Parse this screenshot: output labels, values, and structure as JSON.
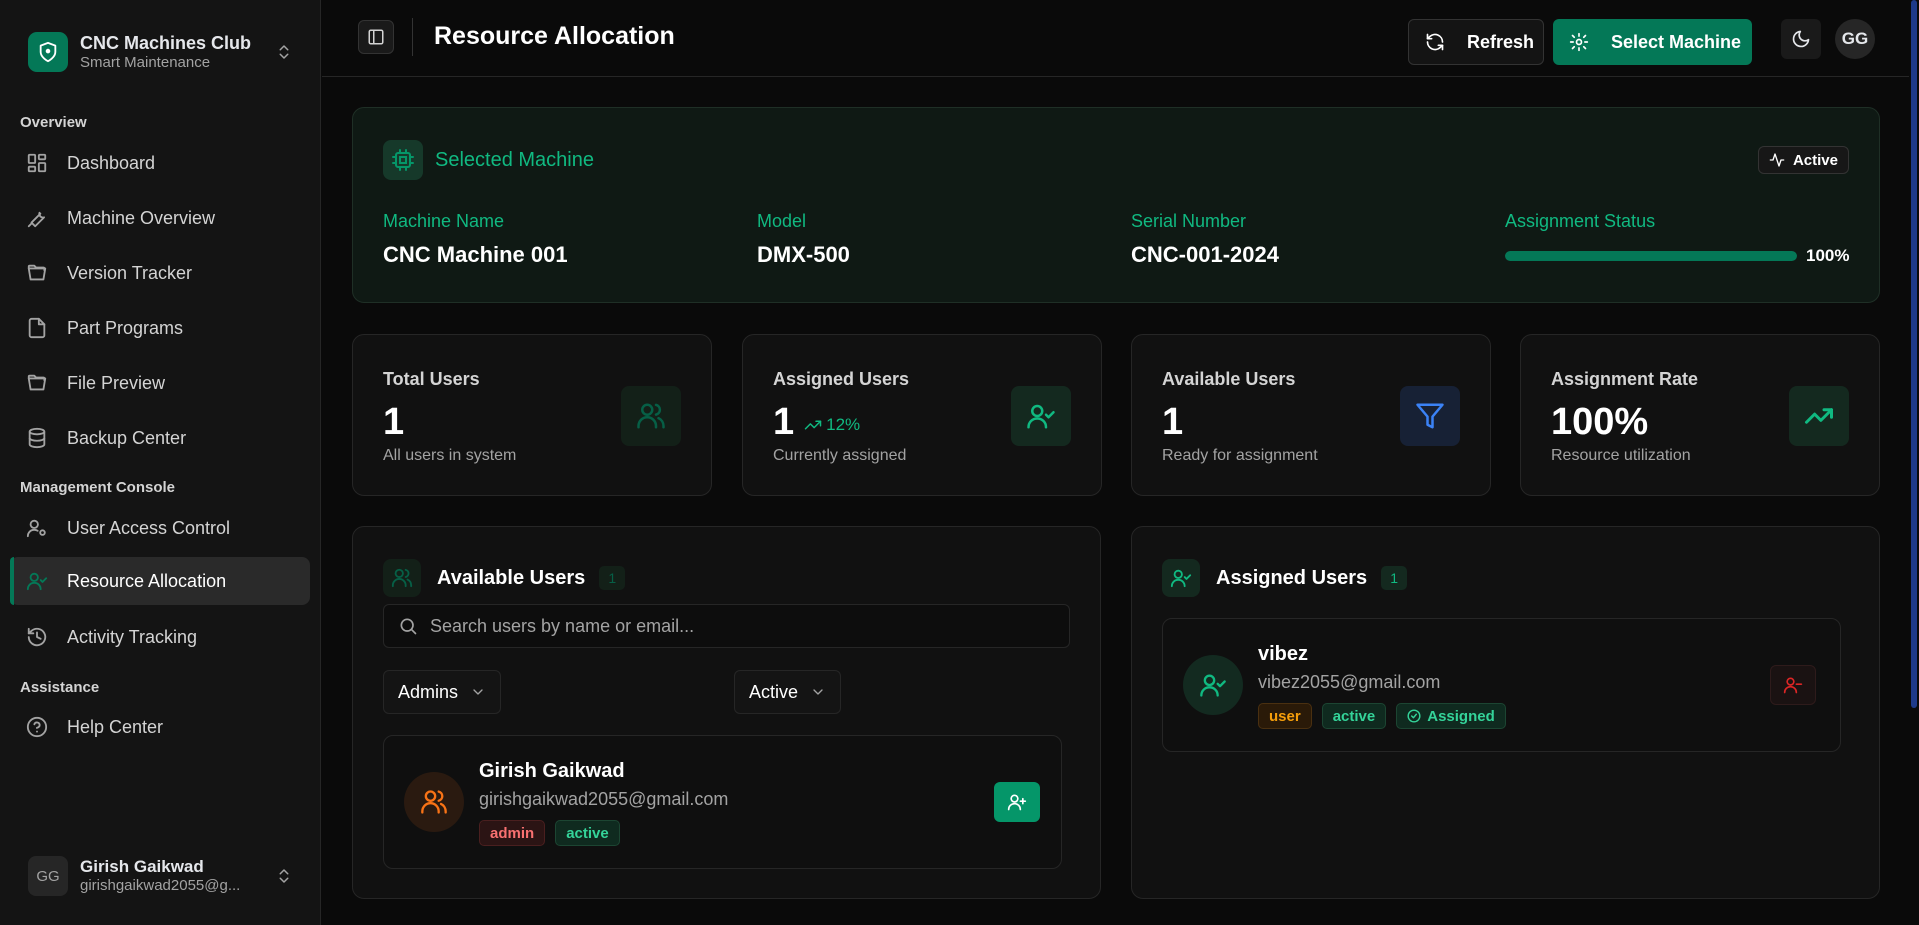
{
  "brand": {
    "name": "CNC Machines Club",
    "subtitle": "Smart Maintenance",
    "logo_icon": "shield-icon",
    "accent": "#047857"
  },
  "sidebar": {
    "groups": [
      {
        "label": "Overview"
      },
      {
        "label": "Management Console"
      },
      {
        "label": "Assistance"
      }
    ],
    "items": [
      {
        "label": "Dashboard",
        "icon": "grid-icon"
      },
      {
        "label": "Machine Overview",
        "icon": "wrench-icon"
      },
      {
        "label": "Version Tracker",
        "icon": "folder-open-icon"
      },
      {
        "label": "Part Programs",
        "icon": "file-icon"
      },
      {
        "label": "File Preview",
        "icon": "folder-open-icon"
      },
      {
        "label": "Backup Center",
        "icon": "database-icon"
      },
      {
        "label": "User Access Control",
        "icon": "user-cog-icon"
      },
      {
        "label": "Resource Allocation",
        "icon": "user-check-icon",
        "active": true
      },
      {
        "label": "Activity Tracking",
        "icon": "history-icon"
      },
      {
        "label": "Help Center",
        "icon": "help-circle-icon"
      }
    ],
    "user": {
      "initials": "GG",
      "name": "Girish Gaikwad",
      "email": "girishgaikwad2055@g..."
    }
  },
  "header": {
    "title": "Resource Allocation",
    "refresh_label": "Refresh",
    "select_machine_label": "Select Machine",
    "avatar_initials": "GG"
  },
  "machine": {
    "heading": "Selected Machine",
    "status_badge": "Active",
    "fields": [
      {
        "key": "Machine Name",
        "value": "CNC Machine 001"
      },
      {
        "key": "Model",
        "value": "DMX-500"
      },
      {
        "key": "Serial Number",
        "value": "CNC-001-2024"
      }
    ],
    "assignment": {
      "label": "Assignment Status",
      "percent": 100,
      "percent_label": "100%"
    }
  },
  "stats": [
    {
      "label": "Total Users",
      "value": "1",
      "sub": "All users in system",
      "icon": "users-icon",
      "icon_color": "#065f46",
      "icon_bg": "#132018"
    },
    {
      "label": "Assigned Users",
      "value": "1",
      "trend": "12%",
      "sub": "Currently assigned",
      "icon": "user-check-icon",
      "icon_color": "#10b981",
      "icon_bg": "#14291f"
    },
    {
      "label": "Available Users",
      "value": "1",
      "sub": "Ready for assignment",
      "icon": "filter-icon",
      "icon_color": "#3b82f6",
      "icon_bg": "#172135"
    },
    {
      "label": "Assignment Rate",
      "value": "100%",
      "sub": "Resource utilization",
      "icon": "trending-up-icon",
      "icon_color": "#10b981",
      "icon_bg": "#14291f"
    }
  ],
  "available_panel": {
    "title": "Available Users",
    "count": "1",
    "search_placeholder": "Search users by name or email...",
    "role_filter": "Admins",
    "status_filter": "Active",
    "users": [
      {
        "name": "Girish Gaikwad",
        "email": "girishgaikwad2055@gmail.com",
        "tags": [
          "admin",
          "active"
        ]
      }
    ]
  },
  "assigned_panel": {
    "title": "Assigned Users",
    "count": "1",
    "users": [
      {
        "name": "vibez",
        "email": "vibez2055@gmail.com",
        "tags": [
          "user",
          "active"
        ],
        "assigned_label": "Assigned"
      }
    ]
  }
}
